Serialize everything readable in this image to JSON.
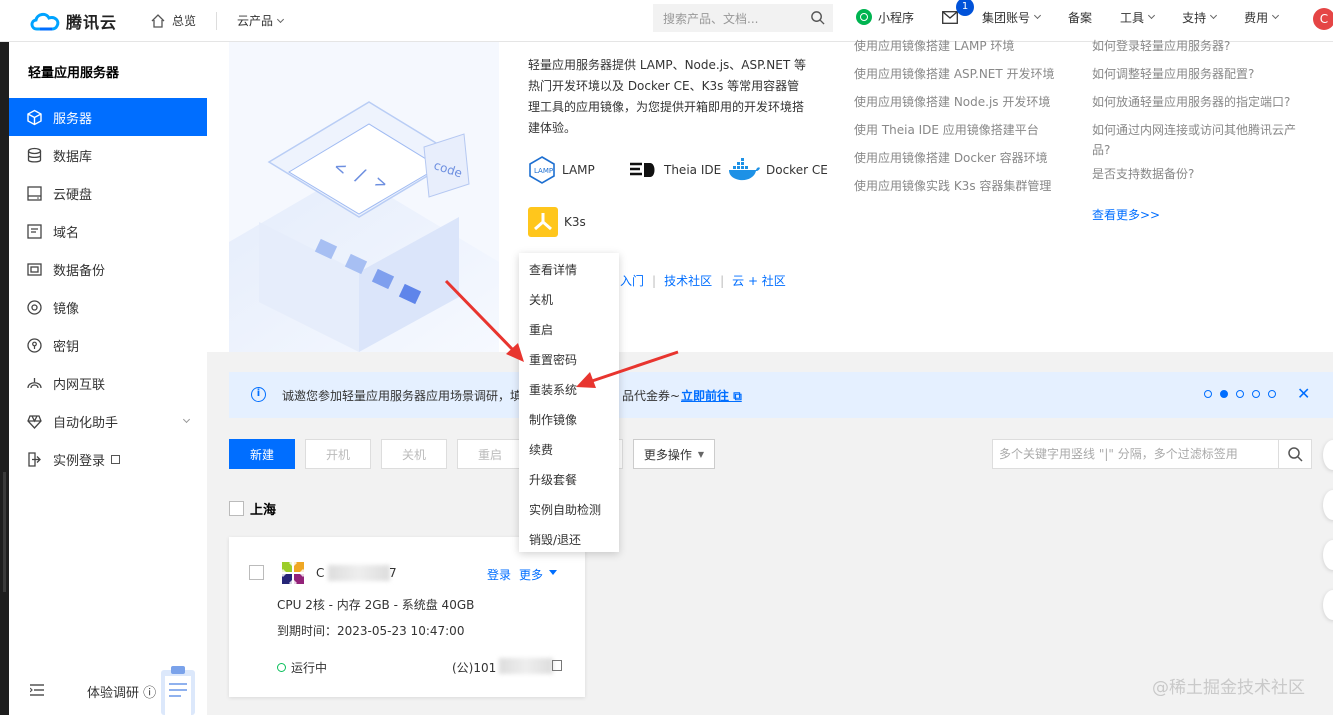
{
  "topbar": {
    "brand": "腾讯云",
    "home": "总览",
    "products": "云产品",
    "search_placeholder": "搜索产品、文档...",
    "mini_program": "小程序",
    "mail_badge": "1",
    "group_account": "集团账号",
    "beian": "备案",
    "tools": "工具",
    "support": "支持",
    "billing": "费用",
    "avatar": "C"
  },
  "sidebar": {
    "title": "轻量应用服务器",
    "items": [
      {
        "label": "服务器",
        "icon": "cube-icon"
      },
      {
        "label": "数据库",
        "icon": "database-icon"
      },
      {
        "label": "云硬盘",
        "icon": "disk-icon"
      },
      {
        "label": "域名",
        "icon": "domain-icon"
      },
      {
        "label": "数据备份",
        "icon": "backup-icon"
      },
      {
        "label": "镜像",
        "icon": "image-icon"
      },
      {
        "label": "密钥",
        "icon": "key-icon"
      },
      {
        "label": "内网互联",
        "icon": "network-icon"
      },
      {
        "label": "自动化助手",
        "icon": "automation-icon"
      },
      {
        "label": "实例登录",
        "icon": "terminal-icon"
      }
    ],
    "feedback": "体验调研"
  },
  "intro": {
    "text": "轻量应用服务器提供 LAMP、Node.js、ASP.NET 等热门开发环境以及 Docker CE、K3s 等常用容器管理工具的应用镜像，为您提供开箱即用的开发环境搭建体验。",
    "tools": [
      "LAMP",
      "Theia IDE",
      "Docker CE",
      "K3s"
    ],
    "link_partial": "入门",
    "link_community": "技术社区",
    "link_cloud_plus": "云 + 社区"
  },
  "tutorials": [
    "使用应用镜像搭建 LAMP 环境",
    "使用应用镜像搭建 ASP.NET 开发环境",
    "使用应用镜像搭建 Node.js 开发环境",
    "使用 Theia IDE 应用镜像搭建平台",
    "使用应用镜像搭建 Docker 容器环境",
    "使用应用镜像实践 K3s 容器集群管理"
  ],
  "faq": [
    "如何登录轻量应用服务器?",
    "如何调整轻量应用服务器配置?",
    "如何放通轻量应用服务器的指定端口?",
    "如何通过内网连接或访问其他腾讯云产",
    "品?",
    "是否支持数据备份?"
  ],
  "faq_more": "查看更多>>",
  "notice": {
    "text_left": "诚邀您参加轻量应用服务器应用场景调研，填",
    "text_right": "品代金券~",
    "action": "立即前往"
  },
  "toolbar": {
    "new": "新建",
    "start": "开机",
    "stop": "关机",
    "restart": "重启",
    "more_ops": "更多操作",
    "filter_placeholder": "多个关键字用竖线 \"|\" 分隔，多个过滤标签用"
  },
  "region": "上海",
  "instance": {
    "name_prefix": "C",
    "name_suffix": "7",
    "login": "登录",
    "more": "更多",
    "spec": "CPU 2核 - 内存 2GB - 系统盘 40GB",
    "expire": "到期时间：2023-05-23 10:47:00",
    "status": "运行中",
    "ip_prefix": "(公)101"
  },
  "dropdown": [
    "查看详情",
    "关机",
    "重启",
    "重置密码",
    "重装系统",
    "制作镜像",
    "续费",
    "升级套餐",
    "实例自助检测",
    "销毁/退还"
  ],
  "hero_code_label": "code",
  "watermark": "@稀土掘金技术社区",
  "colors": {
    "primary": "#006eff",
    "sidebar_active": "#006eff",
    "status_running": "#0abf5b",
    "arrow": "#e8352f"
  }
}
